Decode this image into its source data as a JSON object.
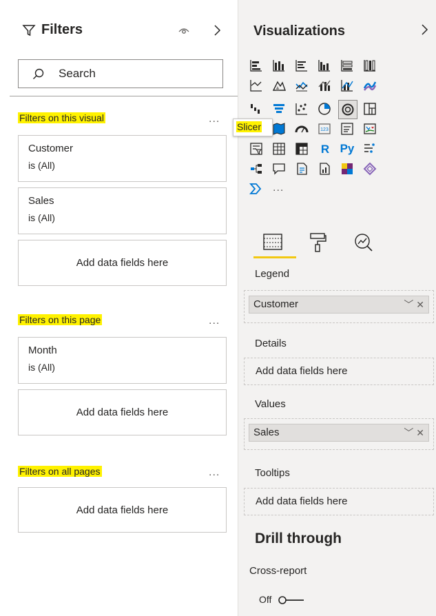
{
  "filters": {
    "title": "Filters",
    "search_placeholder": "Search",
    "sections": [
      {
        "label": "Filters on this visual"
      },
      {
        "label": "Filters on this page"
      },
      {
        "label": "Filters on all pages"
      }
    ],
    "more": "...",
    "cards": [
      {
        "name": "Customer",
        "state": "is (All)"
      },
      {
        "name": "Sales",
        "state": "is (All)"
      },
      {
        "name": "Month",
        "state": "is (All)"
      }
    ],
    "add_fields": "Add data fields here"
  },
  "viz": {
    "title": "Visualizations",
    "tooltip": "Slicer",
    "more": "...",
    "r_label": "R",
    "py_label": "Py",
    "num_label": "123",
    "wells": {
      "legend": {
        "label": "Legend",
        "value": "Customer"
      },
      "details": {
        "label": "Details",
        "placeholder": "Add data fields here"
      },
      "values": {
        "label": "Values",
        "value": "Sales"
      },
      "tooltips": {
        "label": "Tooltips",
        "placeholder": "Add data fields here"
      }
    },
    "drill_through": "Drill through",
    "cross_report": "Cross-report",
    "toggle_state": "Off"
  },
  "colors": {
    "highlight": "#fff200",
    "accent": "#f2c811",
    "panel": "#f3f2f1"
  }
}
